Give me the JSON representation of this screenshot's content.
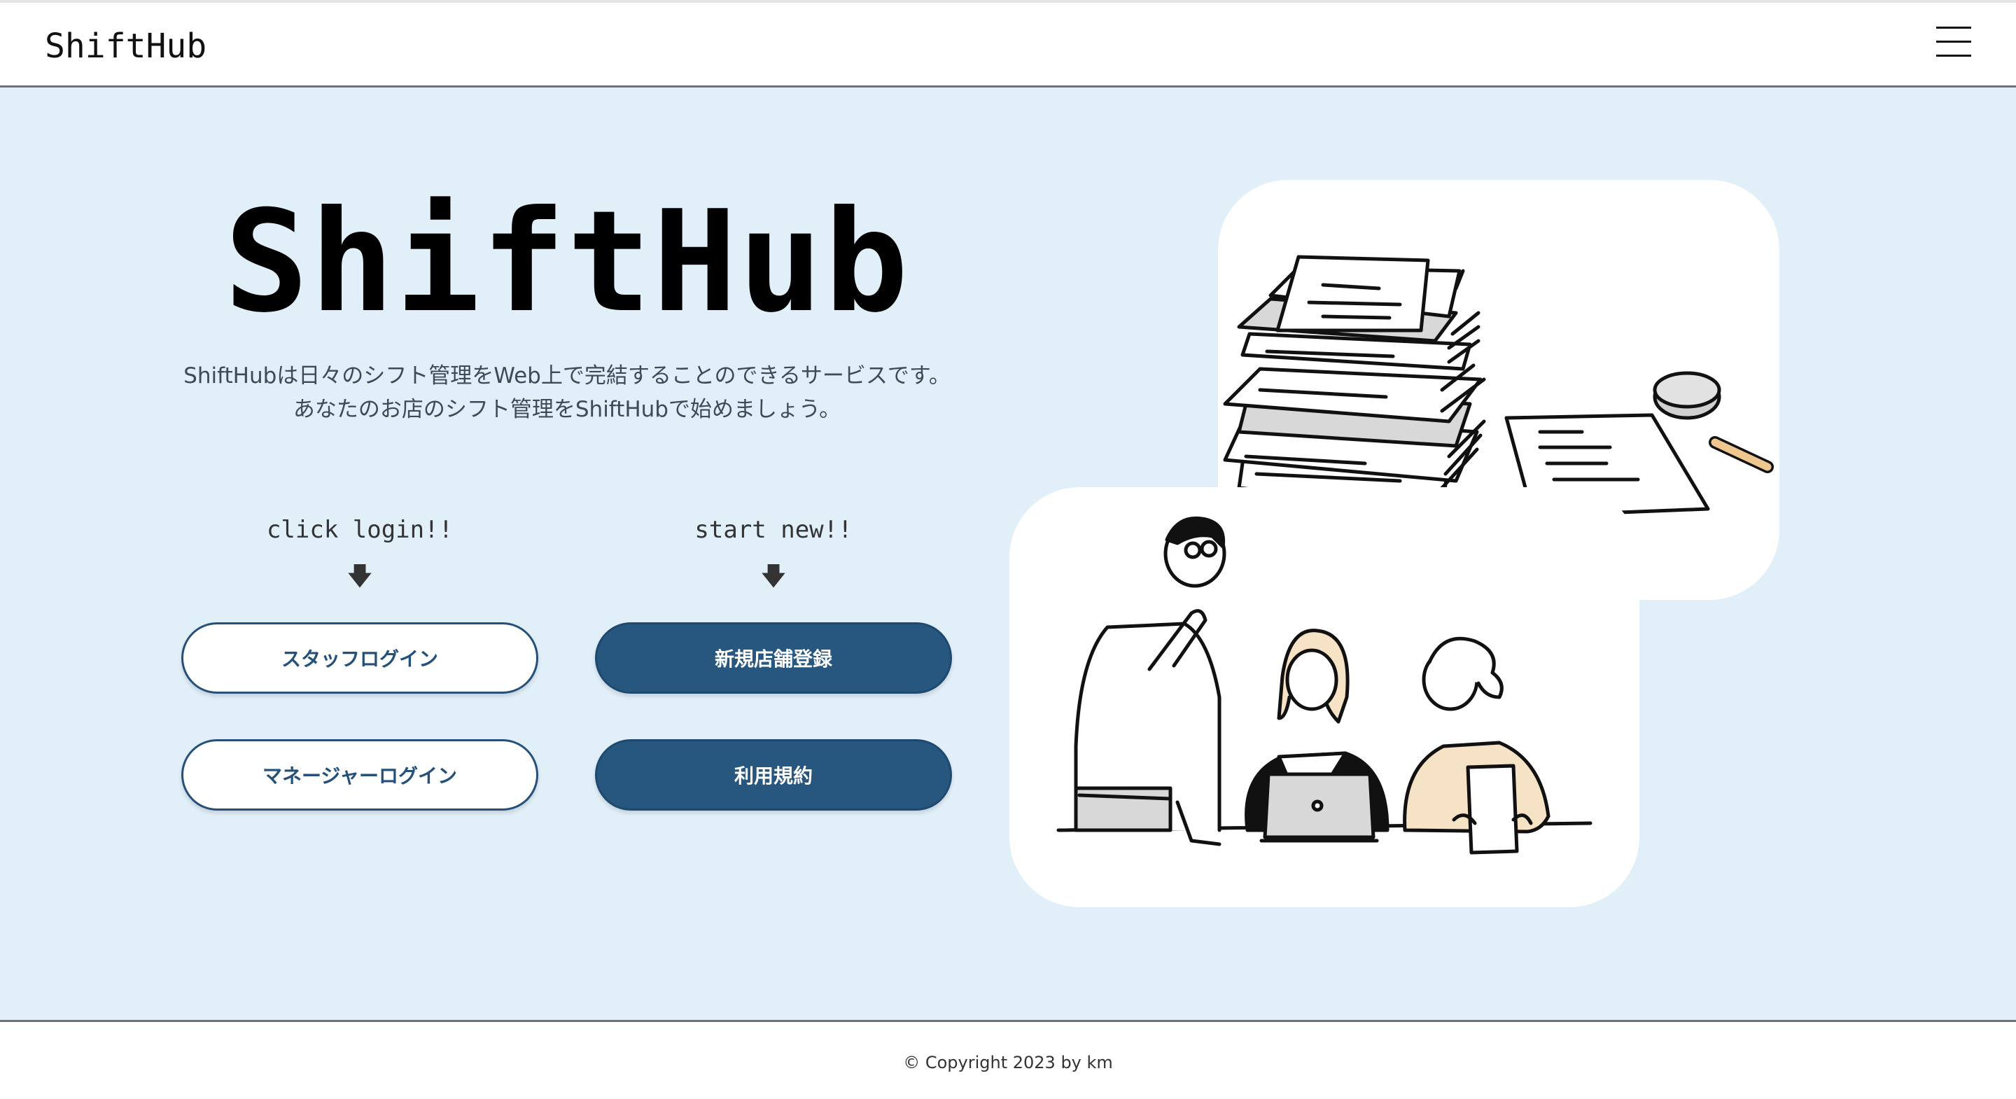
{
  "header": {
    "brand": "ShiftHub",
    "menu_icon": "hamburger-menu-icon"
  },
  "hero": {
    "title": "ShiftHub",
    "description_line1": "ShiftHubは日々のシフト管理をWeb上で完結することのできるサービスです。",
    "description_line2": "あなたのお店のシフト管理をShiftHubで始めましょう。"
  },
  "login_column": {
    "caption": "click login!!",
    "arrow": "🡇",
    "staff_login_label": "スタッフログイン",
    "manager_login_label": "マネージャーログイン"
  },
  "new_column": {
    "caption": "start new!!",
    "arrow": "🡇",
    "register_store_label": "新規店舗登録",
    "terms_label": "利用規約"
  },
  "illustrations": {
    "top": "stacked-documents-illustration",
    "bottom": "team-meeting-illustration"
  },
  "colors": {
    "hero_background": "#e1eff9",
    "primary": "#27567f",
    "skin_accent": "#f6e2c4"
  },
  "footer": {
    "copyright": "© Copyright 2023 by km"
  }
}
